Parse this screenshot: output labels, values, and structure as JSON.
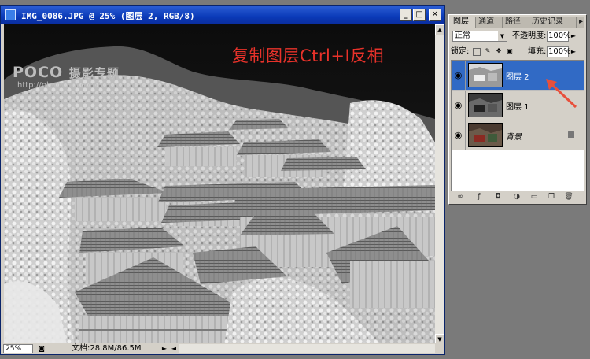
{
  "document": {
    "title": "IMG_0086.JPG @ 25% (图层 2, RGB/8)",
    "window_buttons": {
      "minimize": "_",
      "maximize": "□",
      "close": "✕"
    },
    "overlay_caption": "复制图层Ctrl+I反相",
    "watermark": {
      "brand": "POCO",
      "brand_suffix": "摄影专题",
      "url": "http://photo.poco.cn/"
    },
    "status": {
      "zoom": "25%",
      "doc_size": "文档:28.8M/86.5M"
    }
  },
  "layers_panel": {
    "tabs": [
      "图层",
      "通道",
      "路径",
      "历史记录"
    ],
    "active_tab": 0,
    "blend_mode": "正常",
    "opacity_label": "不透明度:",
    "opacity_value": "100%",
    "lock_label": "锁定:",
    "fill_label": "填充:",
    "fill_value": "100%",
    "layers": [
      {
        "name": "图层 2",
        "selected": true,
        "visible": true,
        "locked": false
      },
      {
        "name": "图层 1",
        "selected": false,
        "visible": true,
        "locked": false
      },
      {
        "name": "背景",
        "selected": false,
        "visible": true,
        "locked": true
      }
    ],
    "bottom_icons": [
      "link-icon",
      "layer-style-icon",
      "mask-icon",
      "adjustment-icon",
      "group-icon",
      "new-layer-icon",
      "trash-icon"
    ]
  },
  "colors": {
    "title_bar": "#0a3ab8",
    "selection": "#316ac5",
    "caption": "#e8322a",
    "annotation_arrow": "#e8503c"
  }
}
